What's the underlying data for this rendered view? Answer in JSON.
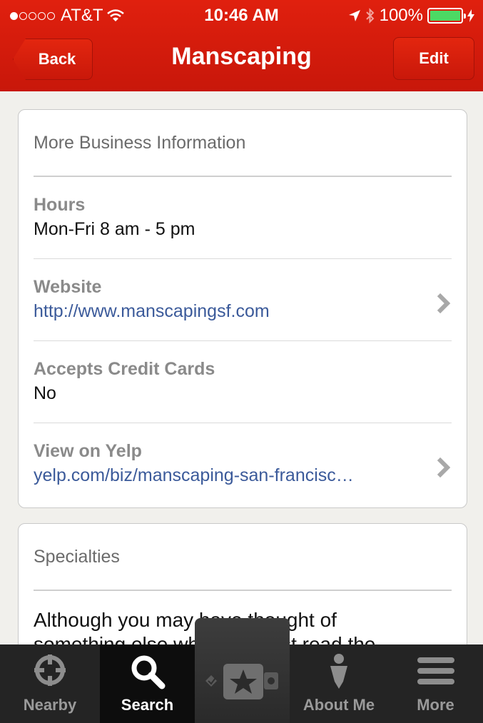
{
  "status_bar": {
    "carrier": "AT&T",
    "time": "10:46 AM",
    "battery": "100%",
    "signal_bars_filled": 1,
    "signal_bars_total": 5
  },
  "nav": {
    "back_label": "Back",
    "title": "Manscaping",
    "edit_label": "Edit"
  },
  "business_info": {
    "section_title": "More Business Information",
    "rows": [
      {
        "label": "Hours",
        "value": "Mon-Fri 8 am - 5 pm"
      },
      {
        "label": "Website",
        "value": "http://www.manscapingsf.com"
      },
      {
        "label": "Accepts Credit Cards",
        "value": "No"
      },
      {
        "label": "View on Yelp",
        "value": "yelp.com/biz/manscaping-san-francisc…"
      }
    ]
  },
  "specialties": {
    "section_title": "Specialties",
    "text": "Although you may have thought of something else when you first read the"
  },
  "tabs": [
    {
      "label": "Nearby",
      "icon": "crosshair-icon"
    },
    {
      "label": "Search",
      "icon": "search-icon"
    },
    {
      "label": "",
      "icon": "check-in-star-camera-icon"
    },
    {
      "label": "About Me",
      "icon": "person-icon"
    },
    {
      "label": "More",
      "icon": "menu-icon"
    }
  ],
  "colors": {
    "brand_red": "#d51f0f",
    "link_blue": "#3b5a9a",
    "battery_green": "#4cd964"
  }
}
